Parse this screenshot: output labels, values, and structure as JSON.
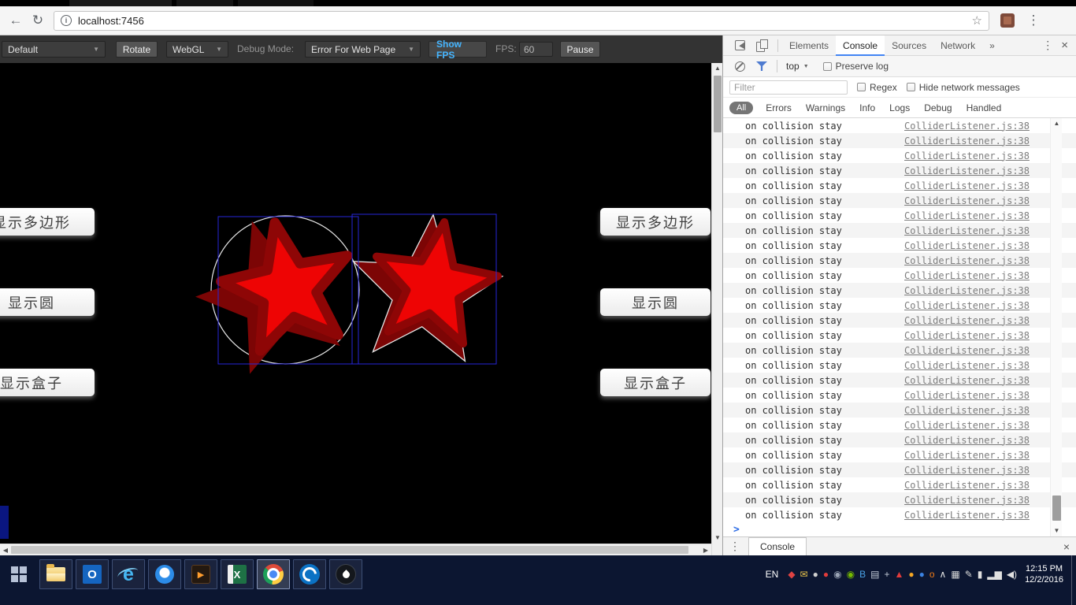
{
  "browser": {
    "url": "localhost:7456",
    "icons": {
      "back": "←",
      "reload": "↻",
      "info": "i",
      "bookmark_star": "☆",
      "menu": "⋮"
    }
  },
  "game_toolbar": {
    "scene_select": "Default",
    "rotate": "Rotate",
    "renderer_select": "WebGL",
    "debug_mode_label": "Debug Mode:",
    "debug_mode_value": "Error For Web Page",
    "show_fps": "Show FPS",
    "fps_label": "FPS:",
    "fps_value": "60",
    "pause": "Pause",
    "dropdown_arrow": "▼"
  },
  "game": {
    "left_buttons": [
      "显示多边形",
      "显示圆",
      "显示盒子"
    ],
    "right_buttons": [
      "显示多边形",
      "显示圆",
      "显示盒子"
    ],
    "colors": {
      "star_fill": "#ee0404",
      "star_outline": "#8e0606",
      "star_shadow": "#7c0505",
      "bounds_blue": "#2626d9",
      "circle_outline": "#e6e6e6"
    }
  },
  "devtools": {
    "tabs": [
      "Elements",
      "Console",
      "Sources",
      "Network"
    ],
    "active_tab": "Console",
    "tabs_overflow": "»",
    "context_select": "top",
    "preserve_log": "Preserve log",
    "filter_placeholder": "Filter",
    "regex_label": "Regex",
    "hide_network_label": "Hide network messages",
    "level_all": "All",
    "levels": [
      "Errors",
      "Warnings",
      "Info",
      "Logs",
      "Debug",
      "Handled"
    ],
    "console_rows": {
      "message": "on collision stay",
      "source": "ColliderListener.js:38",
      "count": 27
    },
    "prompt_chevron": ">",
    "drawer_tab": "Console",
    "icons": {
      "menu": "⋮",
      "close": "×"
    }
  },
  "taskbar": {
    "language": "EN",
    "clock": {
      "time": "12:15 PM",
      "date": "12/2/2016"
    },
    "apps": [
      {
        "name": "start"
      },
      {
        "name": "file-explorer"
      },
      {
        "name": "outlook",
        "glyph": "O"
      },
      {
        "name": "internet-explorer",
        "glyph": "e"
      },
      {
        "name": "qq-browser"
      },
      {
        "name": "media-player",
        "glyph": "▶"
      },
      {
        "name": "excel",
        "glyph": "X"
      },
      {
        "name": "chrome",
        "active": true
      },
      {
        "name": "skype"
      },
      {
        "name": "water-drop"
      }
    ],
    "tray": [
      {
        "name": "antivirus",
        "glyph": "◆",
        "color": "#e04343"
      },
      {
        "name": "mail",
        "glyph": "✉",
        "color": "#e8c34a"
      },
      {
        "name": "sync",
        "glyph": "●",
        "color": "#cfcfcf"
      },
      {
        "name": "music",
        "glyph": "●",
        "color": "#e23b3b"
      },
      {
        "name": "globe",
        "glyph": "◉",
        "color": "#9aa4b5"
      },
      {
        "name": "graphics",
        "glyph": "◉",
        "color": "#76b900"
      },
      {
        "name": "bluetooth",
        "glyph": "B",
        "color": "#4aa3e8"
      },
      {
        "name": "keyboard",
        "glyph": "▤",
        "color": "#c2c9d6"
      },
      {
        "name": "tools",
        "glyph": "+",
        "color": "#c2c9d6"
      },
      {
        "name": "alert",
        "glyph": "▲",
        "color": "#e23b3b"
      },
      {
        "name": "cloud",
        "glyph": "●",
        "color": "#f5a623"
      },
      {
        "name": "drive",
        "glyph": "●",
        "color": "#3b82e2"
      },
      {
        "name": "office",
        "glyph": "o",
        "color": "#f07b16"
      },
      {
        "name": "expand",
        "glyph": "∧",
        "color": "#e0e0e0"
      },
      {
        "name": "ime",
        "glyph": "▦",
        "color": "#d8d8d8"
      },
      {
        "name": "pen",
        "glyph": "✎",
        "color": "#d8d8d8"
      },
      {
        "name": "battery",
        "glyph": "▮",
        "color": "#e0e0e0"
      },
      {
        "name": "network",
        "glyph": "▂▆",
        "color": "#e0e0e0"
      },
      {
        "name": "volume",
        "glyph": "◀)",
        "color": "#e0e0e0"
      }
    ]
  }
}
